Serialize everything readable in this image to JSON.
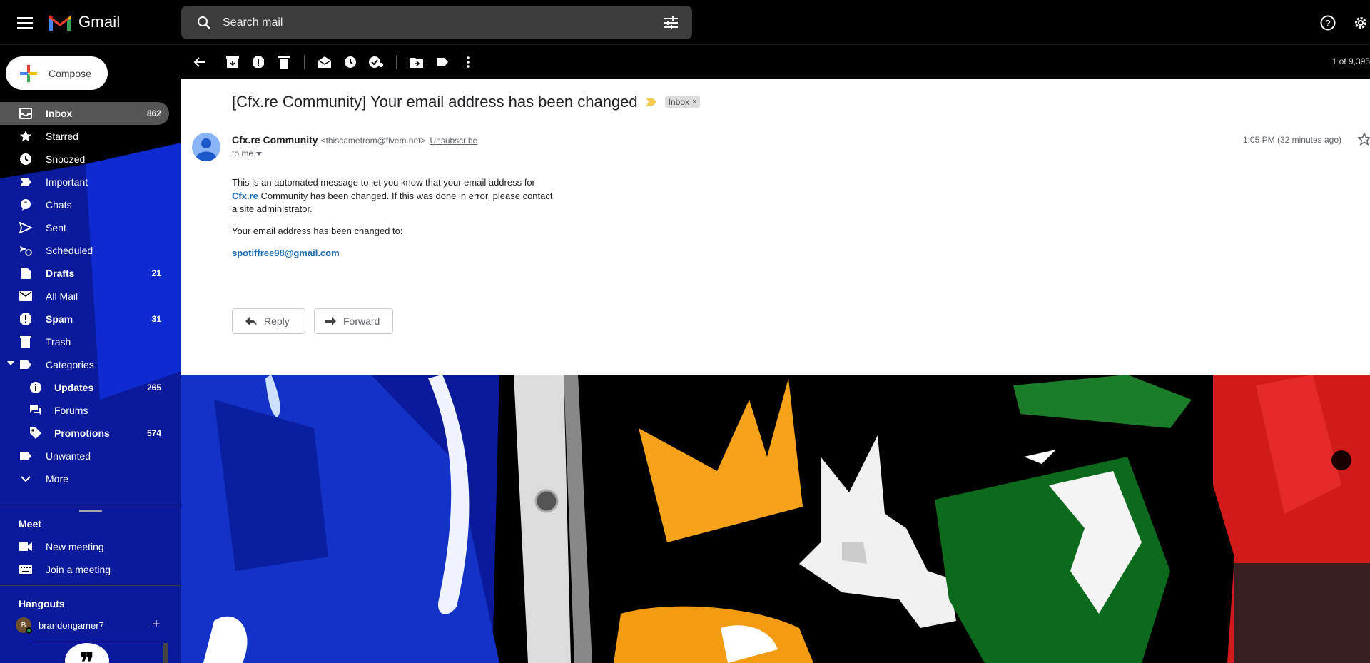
{
  "topbar": {
    "app_name": "Gmail",
    "search_placeholder": "Search mail"
  },
  "sidebar": {
    "compose_label": "Compose",
    "items": [
      {
        "label": "Inbox",
        "count": "862",
        "icon": "inbox-icon"
      },
      {
        "label": "Starred",
        "count": "",
        "icon": "star-icon"
      },
      {
        "label": "Snoozed",
        "count": "",
        "icon": "clock-icon"
      },
      {
        "label": "Important",
        "count": "",
        "icon": "important-icon"
      },
      {
        "label": "Chats",
        "count": "",
        "icon": "chat-icon"
      },
      {
        "label": "Sent",
        "count": "",
        "icon": "send-icon"
      },
      {
        "label": "Scheduled",
        "count": "",
        "icon": "scheduled-icon"
      },
      {
        "label": "Drafts",
        "count": "21",
        "icon": "draft-icon"
      },
      {
        "label": "All Mail",
        "count": "",
        "icon": "mail-icon"
      },
      {
        "label": "Spam",
        "count": "31",
        "icon": "spam-icon"
      },
      {
        "label": "Trash",
        "count": "",
        "icon": "trash-icon"
      },
      {
        "label": "Categories",
        "count": "",
        "icon": "label-icon"
      },
      {
        "label": "Updates",
        "count": "265",
        "icon": "info-icon"
      },
      {
        "label": "Forums",
        "count": "",
        "icon": "forum-icon"
      },
      {
        "label": "Promotions",
        "count": "574",
        "icon": "tag-icon"
      },
      {
        "label": "Unwanted",
        "count": "",
        "icon": "label-icon"
      },
      {
        "label": "More",
        "count": "",
        "icon": "chevron-down-icon"
      }
    ]
  },
  "meet": {
    "title": "Meet",
    "new_meeting": "New meeting",
    "join_meeting": "Join a meeting"
  },
  "hangouts": {
    "title": "Hangouts",
    "user": "brandongamer7",
    "avatar_letter": "B",
    "add": "+",
    "quote_mark": "❞"
  },
  "toolbar": {
    "page_count": "1 of 9,395"
  },
  "message": {
    "subject": "[Cfx.re Community] Your email address has been changed",
    "label_chip": "Inbox",
    "chip_close": "×",
    "sender_name": "Cfx.re Community",
    "sender_email": "<thiscamefrom@fivem.net>",
    "unsubscribe": "Unsubscribe",
    "to": "to me",
    "time": "1:05 PM (32 minutes ago)",
    "body_line1_a": "This is an automated message to let you know that your email address for",
    "body_link": "Cfx.re",
    "body_line1_b": "Community has been changed. If this was done in error, please contact a site administrator.",
    "body_line2": "Your email address has been changed to:",
    "new_email": "spotiffree98@gmail.com",
    "reply_label": "Reply",
    "forward_label": "Forward"
  },
  "colors": {
    "accent_link": "#1a6bb3",
    "active_nav": "#646464",
    "search_bg": "#3c3c3c"
  }
}
